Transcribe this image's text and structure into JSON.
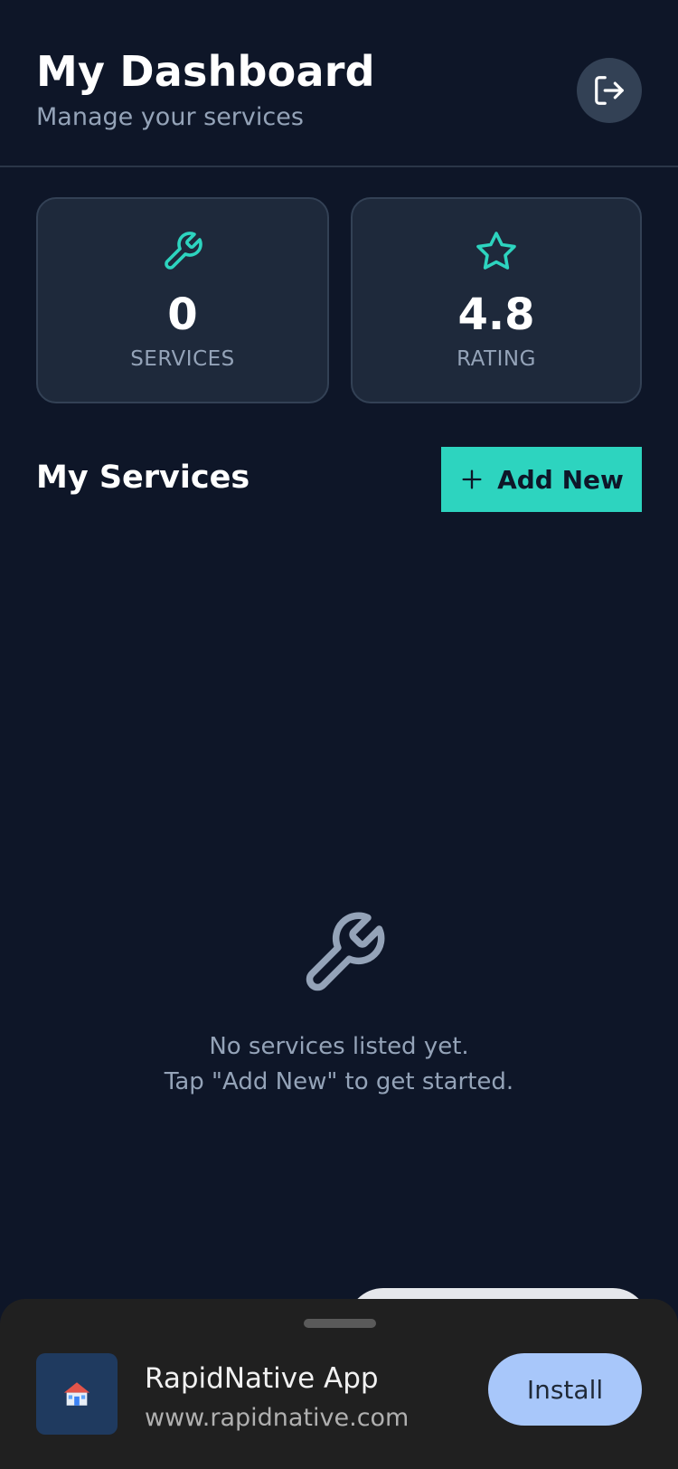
{
  "header": {
    "title": "My Dashboard",
    "subtitle": "Manage your services",
    "logout_icon": "logout-icon"
  },
  "stats": [
    {
      "icon": "wrench-icon",
      "value": "0",
      "label": "SERVICES"
    },
    {
      "icon": "star-icon",
      "value": "4.8",
      "label": "RATING"
    }
  ],
  "services_section": {
    "title": "My Services",
    "add_button_label": "Add New",
    "add_icon": "plus-icon"
  },
  "empty_state": {
    "icon": "wrench-icon",
    "line1": "No services listed yet.",
    "line2": "Tap \"Add New\" to get started."
  },
  "install_banner": {
    "app_name": "RapidNative App",
    "app_url": "www.rapidnative.com",
    "install_label": "Install",
    "app_icon": "house-icon"
  },
  "colors": {
    "background": "#0e1628",
    "card": "#1e293b",
    "accent": "#2dd4bf",
    "muted_text": "#94a3b8",
    "install_button": "#a8c7fa"
  }
}
